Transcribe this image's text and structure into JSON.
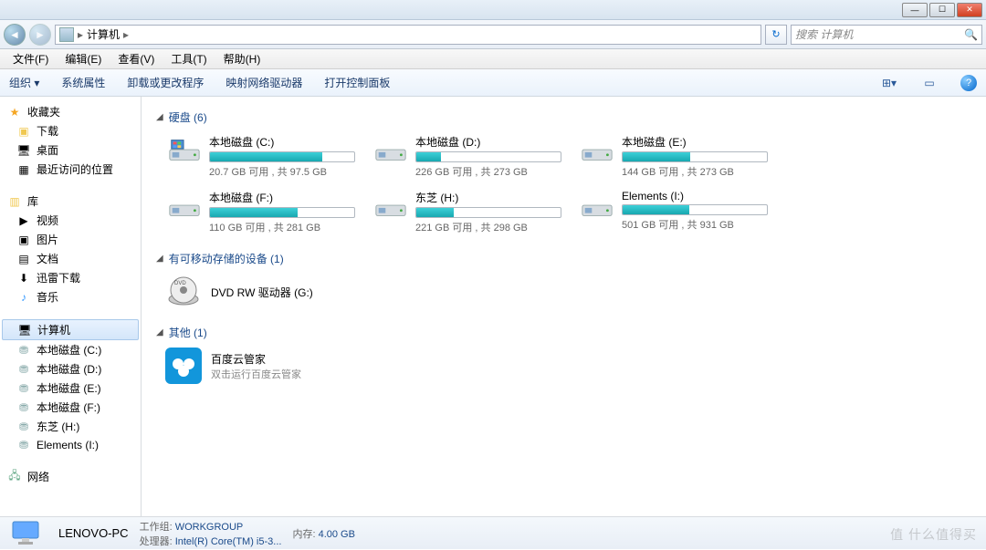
{
  "window": {
    "title": "计算机"
  },
  "nav": {
    "path": "计算机",
    "search_placeholder": "搜索 计算机"
  },
  "menu": {
    "file": "文件(F)",
    "edit": "编辑(E)",
    "view": "查看(V)",
    "tools": "工具(T)",
    "help": "帮助(H)"
  },
  "toolbar": {
    "organize": "组织 ▾",
    "props": "系统属性",
    "uninstall": "卸载或更改程序",
    "mapdrive": "映射网络驱动器",
    "controlpanel": "打开控制面板"
  },
  "sidebar": {
    "favorites": {
      "label": "收藏夹",
      "items": [
        "下载",
        "桌面",
        "最近访问的位置"
      ]
    },
    "libraries": {
      "label": "库",
      "items": [
        "视频",
        "图片",
        "文档",
        "迅雷下载",
        "音乐"
      ]
    },
    "computer": {
      "label": "计算机",
      "items": [
        "本地磁盘 (C:)",
        "本地磁盘 (D:)",
        "本地磁盘 (E:)",
        "本地磁盘 (F:)",
        "东芝 (H:)",
        "Elements (I:)"
      ]
    },
    "network": {
      "label": "网络"
    }
  },
  "categories": {
    "hdd": {
      "label": "硬盘 (6)"
    },
    "removable": {
      "label": "有可移动存储的设备 (1)"
    },
    "other": {
      "label": "其他 (1)"
    }
  },
  "drives": [
    {
      "name": "本地磁盘 (C:)",
      "status": "20.7 GB 可用 , 共 97.5 GB",
      "fill": 78,
      "warn": false
    },
    {
      "name": "本地磁盘 (D:)",
      "status": "226 GB 可用 , 共 273 GB",
      "fill": 17,
      "warn": false
    },
    {
      "name": "本地磁盘 (E:)",
      "status": "144 GB 可用 , 共 273 GB",
      "fill": 47,
      "warn": false
    },
    {
      "name": "本地磁盘 (F:)",
      "status": "110 GB 可用 , 共 281 GB",
      "fill": 61,
      "warn": false
    },
    {
      "name": "东芝 (H:)",
      "status": "221 GB 可用 , 共 298 GB",
      "fill": 26,
      "warn": false
    },
    {
      "name": "Elements (I:)",
      "status": "501 GB 可用 , 共 931 GB",
      "fill": 46,
      "warn": false
    }
  ],
  "dvd": {
    "name": "DVD RW 驱动器 (G:)"
  },
  "other_item": {
    "name": "百度云管家",
    "sub": "双击运行百度云管家"
  },
  "details": {
    "name": "LENOVO-PC",
    "workgroup_label": "工作组:",
    "workgroup": "WORKGROUP",
    "mem_label": "内存:",
    "mem": "4.00 GB",
    "cpu_label": "处理器:",
    "cpu": "Intel(R) Core(TM) i5-3..."
  },
  "watermark": "值 什么值得买"
}
